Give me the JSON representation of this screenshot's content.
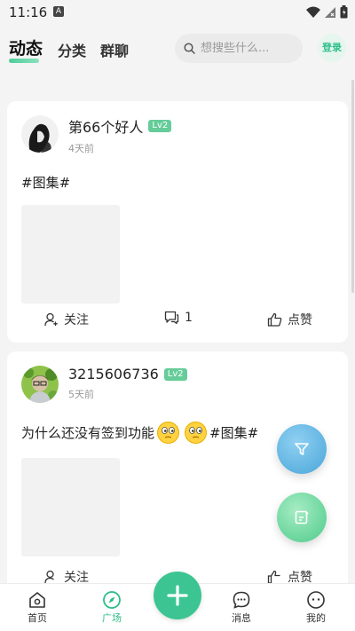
{
  "status": {
    "time": "11:16",
    "a_label": "A"
  },
  "header": {
    "tabs": [
      {
        "label": "动态",
        "active": true
      },
      {
        "label": "分类",
        "active": false
      },
      {
        "label": "群聊",
        "active": false
      }
    ],
    "search_placeholder": "想搜些什么...",
    "login_label": "登录"
  },
  "posts": [
    {
      "username": "第66个好人",
      "level": "Lv2",
      "time": "4天前",
      "text": "#图集#",
      "actions": {
        "follow": "关注",
        "comments": "1",
        "like": "点赞"
      }
    },
    {
      "username": "3215606736",
      "level": "Lv2",
      "time": "5天前",
      "text_before": "为什么还没有签到功能",
      "text_after": "#图集#",
      "actions": {
        "follow": "关注",
        "comments": "",
        "like": "点赞"
      }
    }
  ],
  "bottom_nav": {
    "home": "首页",
    "square": "广场",
    "messages": "消息",
    "mine": "我的"
  },
  "colors": {
    "accent": "#3cc593",
    "active_nav": "#2ebd88",
    "level_badge": "#66cc99"
  },
  "icons": [
    "wifi-icon",
    "signal-icon",
    "battery-icon",
    "search-icon",
    "user-plus-icon",
    "comment-icon",
    "thumb-up-icon",
    "filter-icon",
    "edit-icon",
    "home-icon",
    "compass-icon",
    "plus-icon",
    "message-icon",
    "profile-icon"
  ]
}
